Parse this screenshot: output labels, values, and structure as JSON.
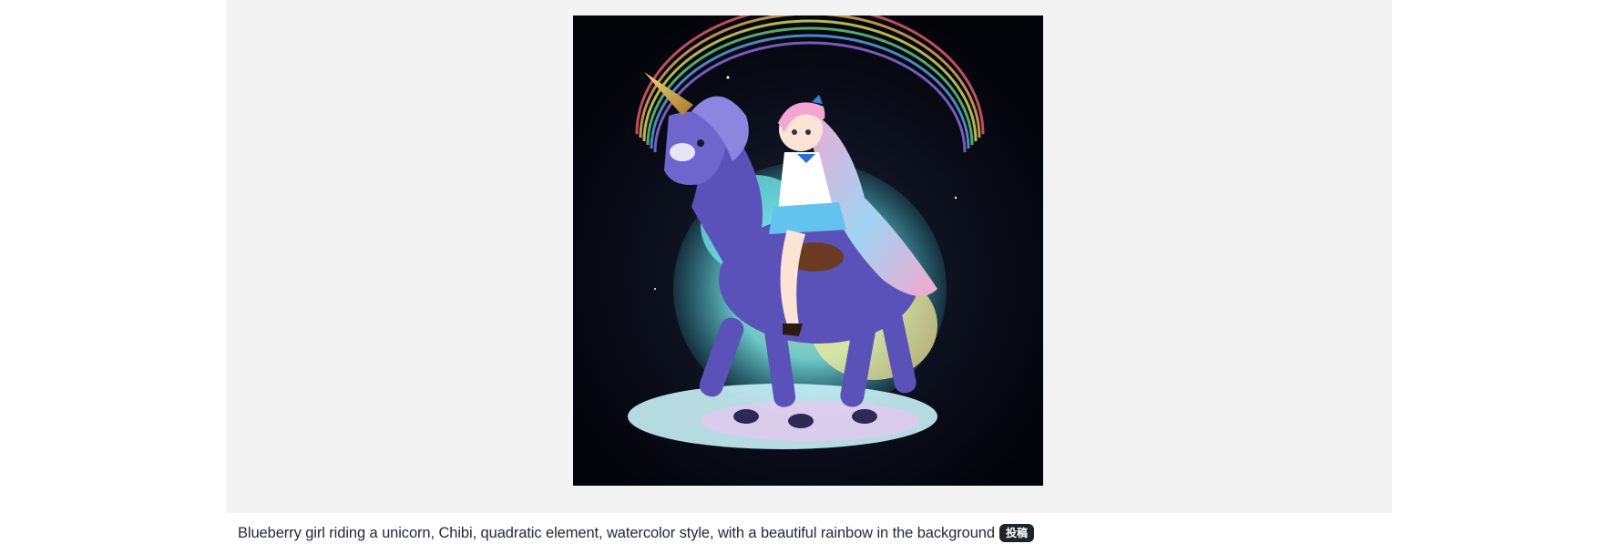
{
  "post": {
    "image_alt": "Blueberry girl riding a unicorn, Chibi, quadratic element, watercolor style, with a beautiful rainbow in the background",
    "caption": "Blueberry girl riding a unicorn, Chibi, quadratic element, watercolor style, with a beautiful rainbow in the background",
    "badge_label": "投稿"
  },
  "colors": {
    "frame_background": "#f3f3f3",
    "badge_background": "#1f2428",
    "caption_text": "#1f2937"
  }
}
